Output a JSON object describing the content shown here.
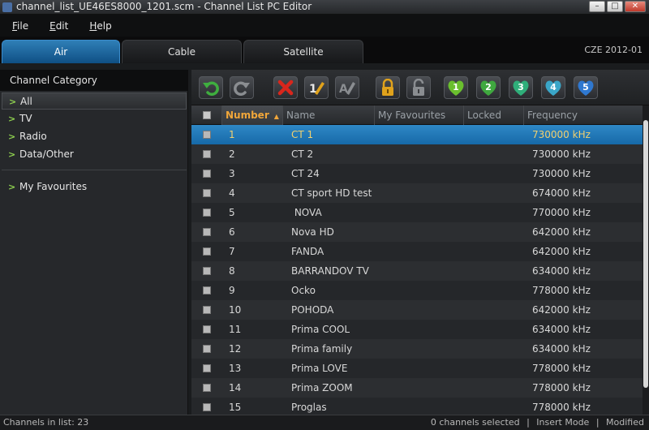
{
  "window": {
    "title": "channel_list_UE46ES8000_1201.scm - Channel List PC Editor",
    "minimize": "–",
    "maximize": "□",
    "close": "✕"
  },
  "menu": {
    "file_first": "F",
    "file_rest": "ile",
    "edit_first": "E",
    "edit_rest": "dit",
    "help_first": "H",
    "help_rest": "elp"
  },
  "tabs": {
    "air": "Air",
    "cable": "Cable",
    "satellite": "Satellite",
    "info": "CZE  2012-01"
  },
  "sidebar": {
    "header": "Channel Category",
    "items": [
      "All",
      "TV",
      "Radio",
      "Data/Other"
    ],
    "favourites": "My Favourites",
    "chevron": ">"
  },
  "toolbar": {
    "fav_numbers": [
      "1",
      "2",
      "3",
      "4",
      "5"
    ],
    "colors": {
      "undo": "#3fae3f",
      "delete": "#d9261c",
      "lock": "#e0a21c",
      "fav1": "#6abf2e",
      "fav2": "#3fa83f",
      "fav3": "#2fae7a",
      "fav4": "#3aa6c8",
      "fav5": "#2f78d0"
    }
  },
  "table": {
    "columns": {
      "number": "Number",
      "name": "Name",
      "favourites": "My Favourites",
      "locked": "Locked",
      "frequency": "Frequency"
    },
    "sort_arrow": "▲",
    "rows": [
      {
        "number": "1",
        "name": "CT 1",
        "frequency": "730000 kHz"
      },
      {
        "number": "2",
        "name": "CT 2",
        "frequency": "730000 kHz"
      },
      {
        "number": "3",
        "name": "CT 24",
        "frequency": "730000 kHz"
      },
      {
        "number": "4",
        "name": "CT sport HD test",
        "frequency": "674000 kHz"
      },
      {
        "number": "5",
        "name": " NOVA",
        "frequency": "770000 kHz"
      },
      {
        "number": "6",
        "name": "Nova HD",
        "frequency": "642000 kHz"
      },
      {
        "number": "7",
        "name": "FANDA",
        "frequency": "642000 kHz"
      },
      {
        "number": "8",
        "name": "BARRANDOV TV",
        "frequency": "634000 kHz"
      },
      {
        "number": "9",
        "name": "Ocko",
        "frequency": "778000 kHz"
      },
      {
        "number": "10",
        "name": "POHODA",
        "frequency": "642000 kHz"
      },
      {
        "number": "11",
        "name": "Prima COOL",
        "frequency": "634000 kHz"
      },
      {
        "number": "12",
        "name": "Prima family",
        "frequency": "634000 kHz"
      },
      {
        "number": "13",
        "name": "Prima LOVE",
        "frequency": "778000 kHz"
      },
      {
        "number": "14",
        "name": "Prima ZOOM",
        "frequency": "778000 kHz"
      },
      {
        "number": "15",
        "name": "Proglas",
        "frequency": "778000 kHz"
      }
    ]
  },
  "status": {
    "channels": "Channels in list: 23",
    "selected": "0 channels selected",
    "separator": "|",
    "mode": "Insert Mode",
    "modified": "Modified"
  }
}
